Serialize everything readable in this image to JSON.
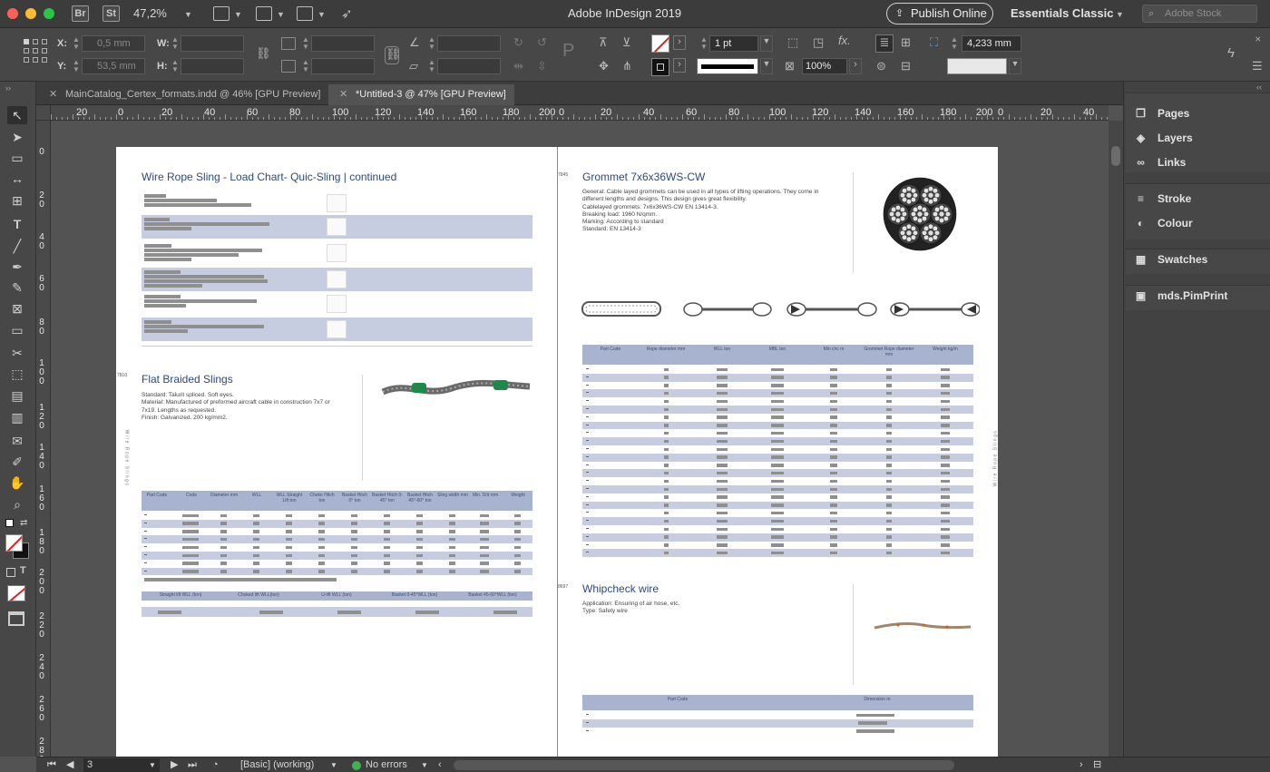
{
  "app": {
    "title": "Adobe InDesign 2019",
    "zoom": "47,2%",
    "publish_label": "Publish Online",
    "workspace": "Essentials Classic",
    "search_placeholder": "Adobe Stock",
    "badges": [
      "Br",
      "St"
    ]
  },
  "control": {
    "x_label": "X:",
    "x_value": "0,5 mm",
    "y_label": "Y:",
    "y_value": "53,5 mm",
    "w_label": "W:",
    "h_label": "H:",
    "stroke_weight": "1 pt",
    "scale": "100%",
    "frame_size": "4,233 mm"
  },
  "tabs": [
    {
      "label": "MainCatalog_Certex_formats.indd @ 46% [GPU Preview]",
      "active": false
    },
    {
      "label": "*Untitled-3 @ 47% [GPU Preview]",
      "active": true
    }
  ],
  "rulers": {
    "h": [
      "20",
      "0",
      "20",
      "40",
      "60",
      "80",
      "100",
      "120",
      "140",
      "160",
      "180",
      "200",
      "0",
      "20",
      "40",
      "60",
      "80",
      "100",
      "120",
      "140",
      "160",
      "180",
      "200",
      "0",
      "20",
      "40"
    ],
    "v": [
      "0",
      "2 0",
      "4 0",
      "6 0",
      "8 0",
      "1 0 0",
      "1 2 0",
      "1 4 0",
      "1 6 0",
      "1 8 0",
      "2 0 0",
      "2 2 0",
      "2 4 0",
      "2 6 0",
      "2 8 0"
    ]
  },
  "left_page": {
    "title": "Wire Rope Sling - Load Chart- Quic-Sling | continued",
    "section_num": "7810",
    "section_title": "Flat Braided Slings",
    "section_text": [
      "Standard: Talurit spliced. Soft eyes.",
      "Material: Manufactured of preformed aircraft cable in construction 7x7 or",
      "7x19. Lengths as requested.",
      "Finish: Galvanized. 200 kg/mm2."
    ],
    "side_label": "Wire Rope Slings",
    "table_headers": [
      "Part Code",
      "Code",
      "Diameter mm",
      "WLL",
      "WLL Straight Lift ton",
      "Choke Hitch ton",
      "Basket Hitch 0° ton",
      "Basket Hitch 0-45° ton",
      "Basket Hitch 45°-60° ton",
      "Sling width mm",
      "Min. D/d mm",
      "Weight"
    ],
    "footer_headers": [
      "Straight lift WLL (ton)",
      "Choked lift WLL(ton)",
      "U-lift WLL (ton)",
      "Basket 0-45°WLL (ton)",
      "Basket 45-60°WLL (ton)"
    ]
  },
  "right_page": {
    "num1": "7845",
    "title1": "Grommet 7x6x36WS-CW",
    "text1": [
      "General: Cable layed grommets can be used in all types of lifting operations. They come in",
      "different lengths and designs. This design gives great flexibility.",
      "Cablelayed grommets: 7x6x36WS-CW EN 13414-3.",
      "Breaking load: 1960 N/qmm.",
      "Marking: According to standard",
      "Standard: EN 13414-3"
    ],
    "table_headers": [
      "Part Code",
      "Rope diameter mm",
      "WLL ton",
      "MBL ton",
      "Min circ m",
      "Grommet Rope diameter mm",
      "Weight kg/m"
    ],
    "num2": "8697",
    "title2": "Whipcheck wire",
    "text2": [
      "Application: Ensuring of air hose, etc.",
      "Type: Safety wire"
    ],
    "table2_headers": [
      "Part Code",
      "Dimension m"
    ],
    "side_label": "Wire Rope Slings"
  },
  "panels": [
    {
      "label": "Pages",
      "icon": "pages-icon",
      "glyph": "❐"
    },
    {
      "label": "Layers",
      "icon": "layers-icon",
      "glyph": "◈"
    },
    {
      "label": "Links",
      "icon": "links-icon",
      "glyph": "∞"
    },
    {
      "label": "Stroke",
      "icon": "stroke-icon",
      "glyph": "≡"
    },
    {
      "label": "Colour",
      "icon": "colour-icon",
      "glyph": "◐"
    },
    {
      "label": "Swatches",
      "icon": "swatches-icon",
      "glyph": "▦"
    },
    {
      "label": "mds.PimPrint",
      "icon": "pimprint-icon",
      "glyph": "▣"
    }
  ],
  "status": {
    "page": "3",
    "style": "[Basic] (working)",
    "errors": "No errors"
  },
  "colors": {
    "accent_blue": "#2c4a7b",
    "table_band": "#c6cde0",
    "ok_green": "#3fb34f"
  }
}
